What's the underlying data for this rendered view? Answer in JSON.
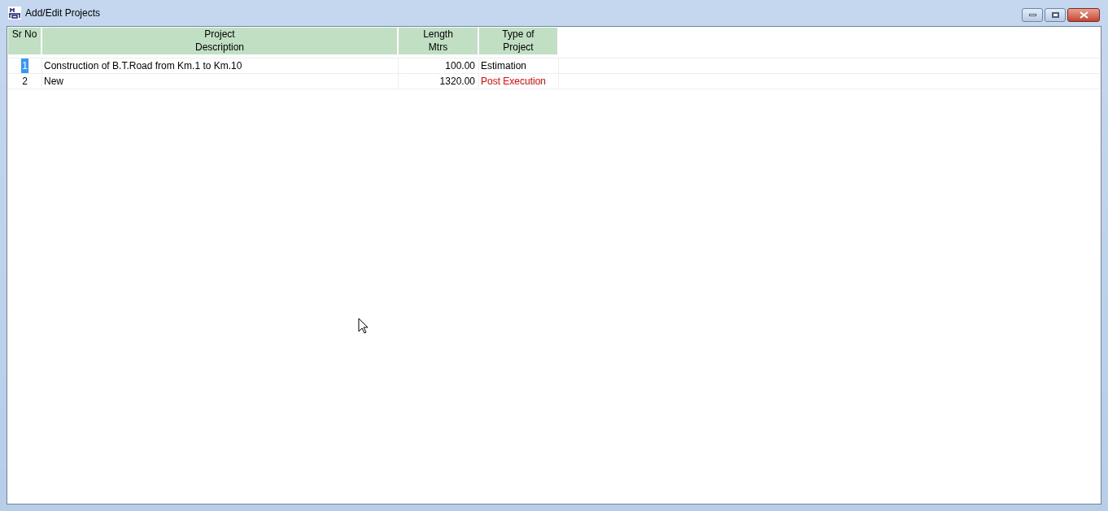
{
  "window": {
    "title": "Add/Edit Projects"
  },
  "table": {
    "columns": [
      {
        "label": "Sr No"
      },
      {
        "label": "Project\nDescription"
      },
      {
        "label": "Length\nMtrs"
      },
      {
        "label": "Type of\nProject"
      }
    ],
    "rows": [
      {
        "sr_no": "1",
        "description": "Construction of B.T.Road from Km.1 to Km.10",
        "length": "100.00",
        "type": "Estimation",
        "color": "#000000",
        "selected": true
      },
      {
        "sr_no": "2",
        "description": "New",
        "length": "1320.00",
        "type": "Post Execution",
        "color": "#ff0000",
        "selected": false
      }
    ]
  }
}
